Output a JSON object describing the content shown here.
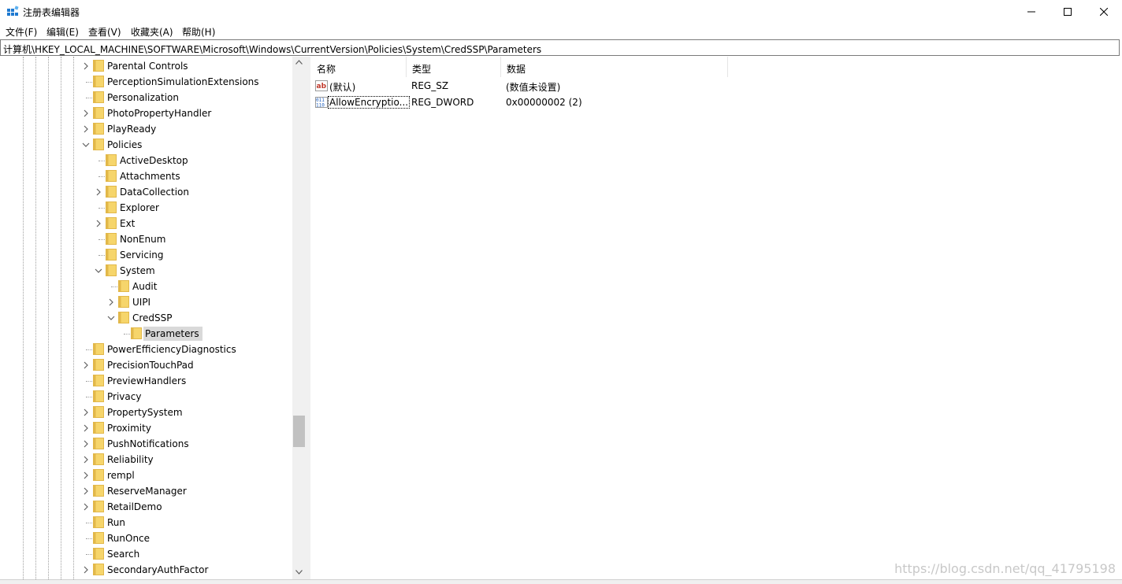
{
  "window": {
    "title": "注册表编辑器",
    "minimize_icon": "minimize-icon",
    "maximize_icon": "maximize-icon",
    "close_icon": "close-icon"
  },
  "menu": {
    "items": [
      "文件(F)",
      "编辑(E)",
      "查看(V)",
      "收藏夹(A)",
      "帮助(H)"
    ]
  },
  "address": {
    "path": "计算机\\HKEY_LOCAL_MACHINE\\SOFTWARE\\Microsoft\\Windows\\CurrentVersion\\Policies\\System\\CredSSP\\Parameters"
  },
  "tree": {
    "nodes": [
      {
        "label": "Parental Controls",
        "expander": "collapsed"
      },
      {
        "label": "PerceptionSimulationExtensions",
        "expander": "none"
      },
      {
        "label": "Personalization",
        "expander": "none"
      },
      {
        "label": "PhotoPropertyHandler",
        "expander": "collapsed"
      },
      {
        "label": "PlayReady",
        "expander": "collapsed"
      },
      {
        "label": "Policies",
        "expander": "expanded"
      },
      {
        "label": "ActiveDesktop",
        "expander": "none"
      },
      {
        "label": "Attachments",
        "expander": "none"
      },
      {
        "label": "DataCollection",
        "expander": "collapsed"
      },
      {
        "label": "Explorer",
        "expander": "none"
      },
      {
        "label": "Ext",
        "expander": "collapsed"
      },
      {
        "label": "NonEnum",
        "expander": "none"
      },
      {
        "label": "Servicing",
        "expander": "none"
      },
      {
        "label": "System",
        "expander": "expanded"
      },
      {
        "label": "Audit",
        "expander": "none"
      },
      {
        "label": "UIPI",
        "expander": "collapsed"
      },
      {
        "label": "CredSSP",
        "expander": "expanded"
      },
      {
        "label": "Parameters",
        "expander": "none",
        "selected": true
      },
      {
        "label": "PowerEfficiencyDiagnostics",
        "expander": "none"
      },
      {
        "label": "PrecisionTouchPad",
        "expander": "collapsed"
      },
      {
        "label": "PreviewHandlers",
        "expander": "none"
      },
      {
        "label": "Privacy",
        "expander": "none"
      },
      {
        "label": "PropertySystem",
        "expander": "collapsed"
      },
      {
        "label": "Proximity",
        "expander": "collapsed"
      },
      {
        "label": "PushNotifications",
        "expander": "collapsed"
      },
      {
        "label": "Reliability",
        "expander": "collapsed"
      },
      {
        "label": "rempl",
        "expander": "collapsed"
      },
      {
        "label": "ReserveManager",
        "expander": "collapsed"
      },
      {
        "label": "RetailDemo",
        "expander": "collapsed"
      },
      {
        "label": "Run",
        "expander": "none"
      },
      {
        "label": "RunOnce",
        "expander": "none"
      },
      {
        "label": "Search",
        "expander": "none"
      },
      {
        "label": "SecondaryAuthFactor",
        "expander": "collapsed"
      }
    ]
  },
  "list": {
    "columns": [
      "名称",
      "类型",
      "数据"
    ],
    "rows": [
      {
        "icon": "string-value-icon",
        "name": "(默认)",
        "type": "REG_SZ",
        "data": "(数值未设置)"
      },
      {
        "icon": "binary-value-icon",
        "name": "AllowEncryptio...",
        "type": "REG_DWORD",
        "data": "0x00000002 (2)"
      }
    ]
  },
  "watermark": "https://blog.csdn.net/qq_41795198",
  "colors": {
    "folder": "#f6d56b",
    "folder_dark": "#e2b84a",
    "selection": "#d9d9d9"
  }
}
